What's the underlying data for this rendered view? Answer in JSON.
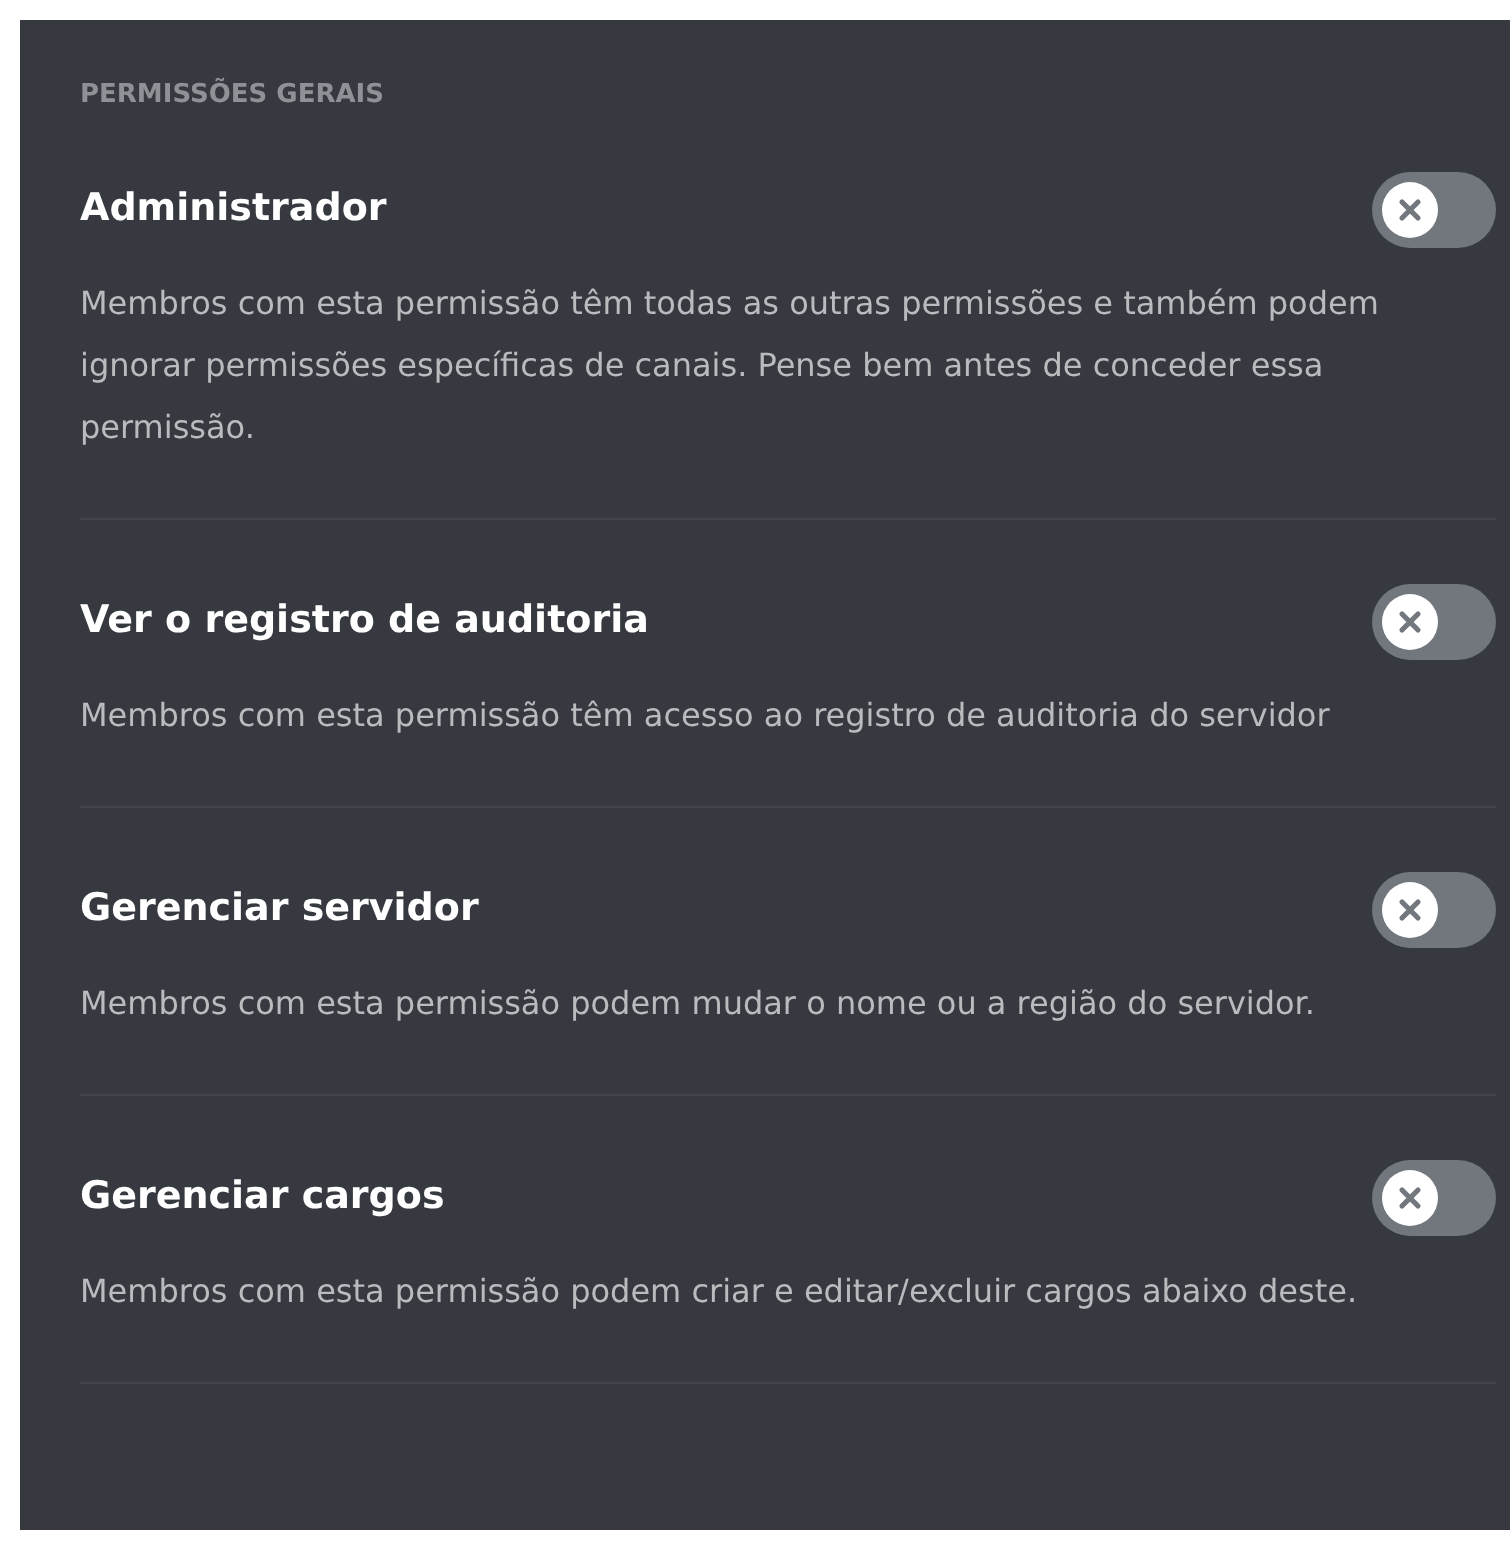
{
  "section_title": "PERMISSÕES GERAIS",
  "permissions": [
    {
      "title": "Administrador",
      "description": "Membros com esta permissão têm todas as outras permissões e também podem ignorar permissões específicas de canais. Pense bem antes de conceder essa permissão.",
      "on": false
    },
    {
      "title": "Ver o registro de auditoria",
      "description": "Membros com esta permissão têm acesso ao registro de auditoria do servidor",
      "on": false
    },
    {
      "title": "Gerenciar servidor",
      "description": "Membros com esta permissão podem mudar o nome ou a região do servidor.",
      "on": false
    },
    {
      "title": "Gerenciar cargos",
      "description": "Membros com esta permissão podem criar e editar/excluir cargos abaixo deste.",
      "on": false
    }
  ]
}
